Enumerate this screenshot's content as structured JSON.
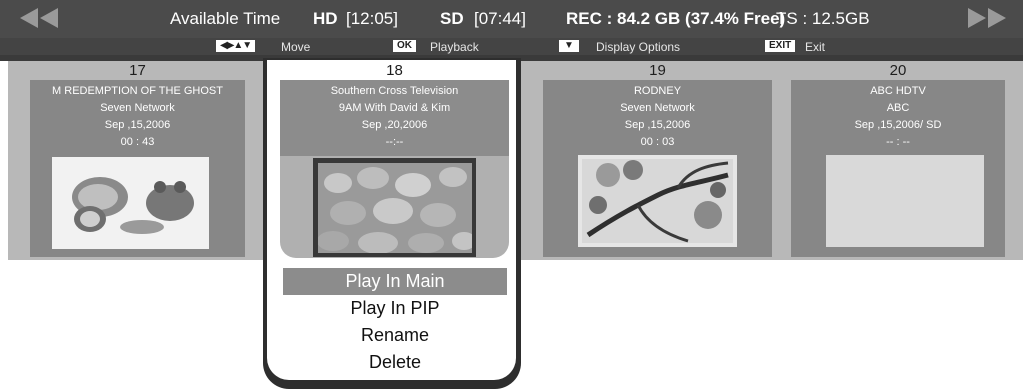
{
  "header": {
    "available_time_label": "Available Time",
    "hd_label": "HD",
    "hd_time": "[12:05]",
    "sd_label": "SD",
    "sd_time": "[07:44]",
    "rec_info": "REC : 84.2 GB (37.4% Free)",
    "ts_info": "TS : 12.5GB",
    "prev_icon": "rewind-icon",
    "next_icon": "fast-forward-icon"
  },
  "hints": {
    "move_key": "◀▶▲▼",
    "move_label": "Move",
    "ok_key": "OK",
    "playback_label": "Playback",
    "display_key": "▼",
    "display_label": "Display Options",
    "exit_key": "EXIT",
    "exit_label": "Exit"
  },
  "recordings": [
    {
      "number": "17",
      "title": "M REDEMPTION OF THE GHOST",
      "channel": "Seven Network",
      "date": "Sep ,15,2006",
      "duration": "00 : 43"
    },
    {
      "number": "18",
      "title": "Southern Cross Television",
      "channel": "9AM With David & Kim",
      "date": "Sep ,20,2006",
      "duration": "--:--"
    },
    {
      "number": "19",
      "title": "RODNEY",
      "channel": "Seven Network",
      "date": "Sep ,15,2006",
      "duration": "00 : 03"
    },
    {
      "number": "20",
      "title": "ABC HDTV",
      "channel": "ABC",
      "date": "Sep ,15,2006/ SD",
      "duration": "-- : --"
    }
  ],
  "menu": {
    "items": [
      "Play In Main",
      "Play In PIP",
      "Rename",
      "Delete"
    ],
    "selected_index": 0
  },
  "colors": {
    "topbar": "#4b4b4b",
    "card_panel": "#878787",
    "selected_highlight": "#8c8c8c"
  }
}
